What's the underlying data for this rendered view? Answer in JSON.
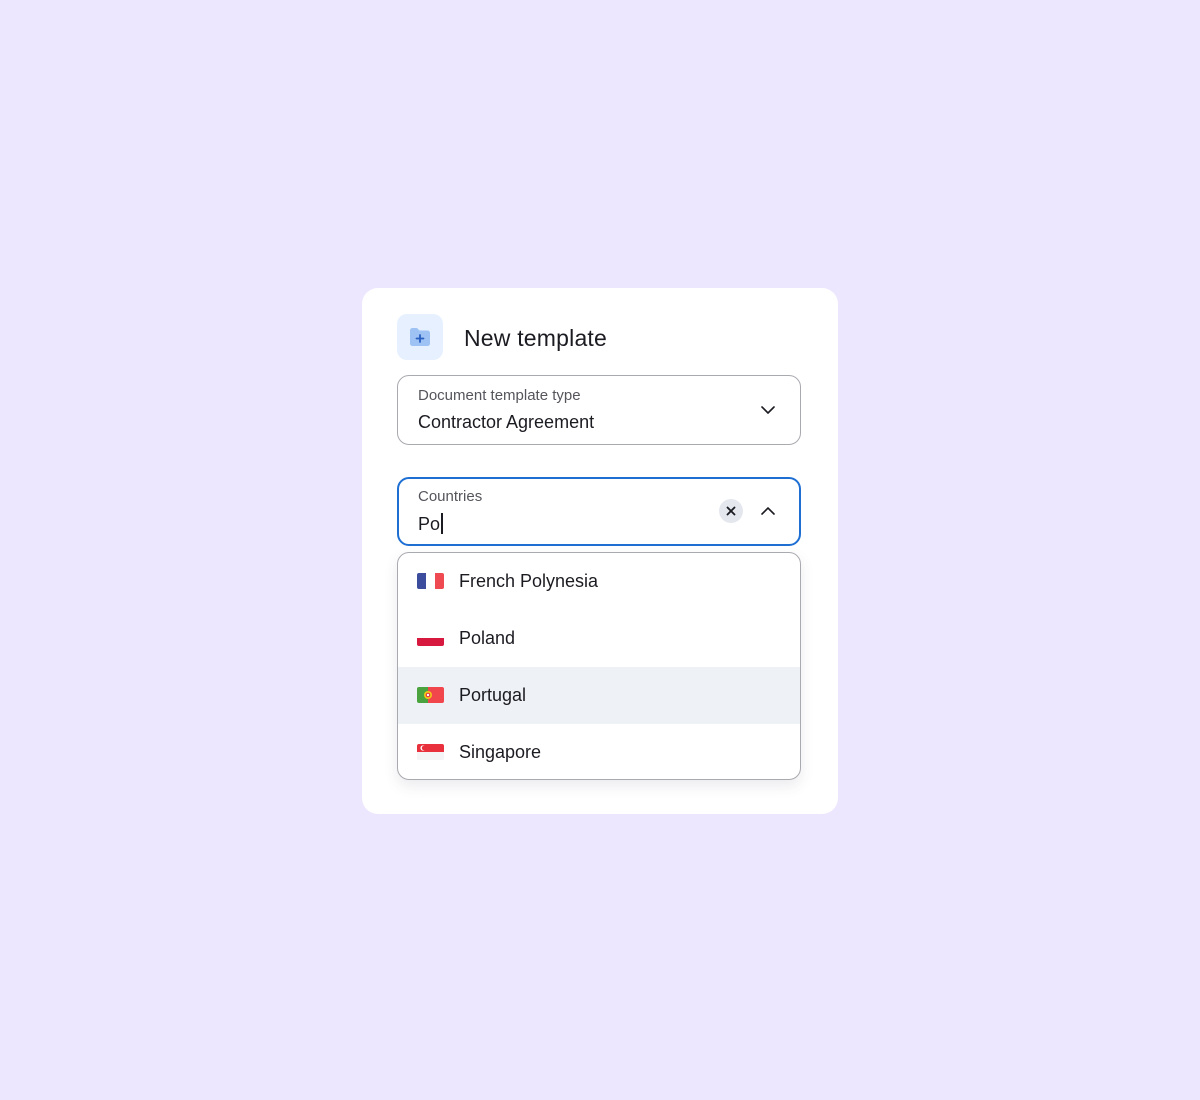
{
  "dialog": {
    "title": "New template",
    "icon": "folder-plus-icon"
  },
  "template_type": {
    "label": "Document template type",
    "value": "Contractor Agreement",
    "icon": "chevron-down-icon"
  },
  "countries": {
    "label": "Countries",
    "value": "Po",
    "clear_icon": "close-icon",
    "toggle_icon": "chevron-up-icon",
    "options": [
      {
        "label": "French Polynesia",
        "flag": "french-polynesia-flag-icon",
        "highlighted": false
      },
      {
        "label": "Poland",
        "flag": "poland-flag-icon",
        "highlighted": false
      },
      {
        "label": "Portugal",
        "flag": "portugal-flag-icon",
        "highlighted": true
      },
      {
        "label": "Singapore",
        "flag": "singapore-flag-icon",
        "highlighted": false
      }
    ]
  },
  "colors": {
    "background": "#ede6ff",
    "accent": "#1f6fd3",
    "highlight_row": "#eef1f5"
  }
}
